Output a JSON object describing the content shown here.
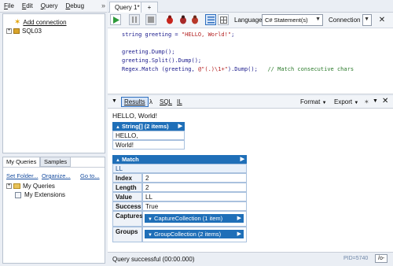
{
  "menubar": {
    "items": [
      {
        "first": "F",
        "rest": "ile"
      },
      {
        "first": "E",
        "rest": "dit"
      },
      {
        "first": "Q",
        "rest": "uery"
      },
      {
        "first": "D",
        "rest": "ebug"
      }
    ],
    "overflow": "»"
  },
  "tree": {
    "add_connection": "Add connection",
    "connection": "SQL03"
  },
  "left_bottom": {
    "tabs": [
      "My Queries",
      "Samples"
    ],
    "links": [
      "Set Folder...",
      "Organize...",
      "Go to..."
    ],
    "items": [
      "My Queries",
      "My Extensions"
    ]
  },
  "doc_tabs": {
    "active": "Query 1*",
    "new_tab": "+"
  },
  "toolbar": {
    "language_label": "Language",
    "language_value": "C# Statement(s)",
    "connection_label": "Connection"
  },
  "editor": {
    "lines": [
      {
        "code": "string greeting = ",
        "str": "\"HELLO, World!\"",
        "tail": ";"
      },
      {
        "code": "",
        "str": "",
        "tail": ""
      },
      {
        "code": "greeting.Dump();",
        "str": "",
        "tail": ""
      },
      {
        "code": "greeting.Split().Dump();",
        "str": "",
        "tail": ""
      },
      {
        "code": "Regex.Match (greeting, ",
        "str": "@\"(.)\\1+\"",
        "tail": ").Dump();",
        "comment": "   // Match consecutive chars"
      }
    ]
  },
  "results_toolbar": {
    "tabs": [
      "Results",
      "λ",
      "SQL",
      "IL"
    ],
    "format": "Format",
    "export": "Export"
  },
  "results": {
    "greeting": "HELLO, World!",
    "string_array": {
      "header": "String[] (2 items)",
      "items": [
        "HELLO,",
        "World!"
      ]
    },
    "match": {
      "header": "Match",
      "value_row": "LL",
      "rows": [
        {
          "key": "Index",
          "value": "2"
        },
        {
          "key": "Length",
          "value": "2"
        },
        {
          "key": "Value",
          "value": "LL"
        },
        {
          "key": "Success",
          "value": "True"
        }
      ],
      "captures_key": "Captures",
      "captures_value": "CaptureCollection (1 item)",
      "groups_key": "Groups",
      "groups_value": "GroupCollection (2 items)"
    }
  },
  "status": {
    "text": "Query successful  (00:00.000)",
    "pid": "PID=5740",
    "mode": "/o-"
  },
  "colors": {
    "dump_header": "#1f6fb8",
    "run_button": "#2e9a3a",
    "accent": "#2f6fbf"
  }
}
